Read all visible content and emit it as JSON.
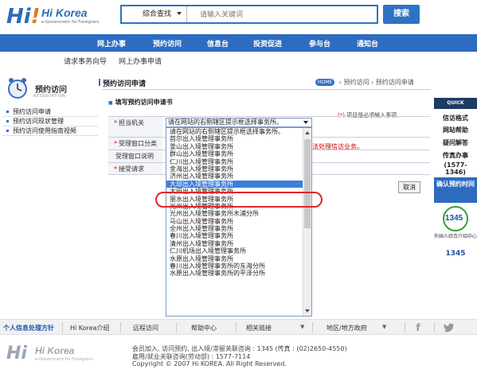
{
  "header": {
    "logo_text": "Hi Korea",
    "logo_sub": "e-Government for Foreigners",
    "search_category": "综合查找",
    "search_placeholder": "请输入关键词",
    "search_button": "搜索"
  },
  "nav": {
    "items": [
      "网上办事",
      "预约访问",
      "信息台",
      "投资促进",
      "参与台",
      "通知台"
    ]
  },
  "subnav": {
    "items": [
      "请求事务向导",
      "网上办事申请"
    ]
  },
  "sidebar": {
    "title": "预约访问",
    "subtitle": "RESERVATION",
    "items": [
      "预约访问申请",
      "预约访问现状管理",
      "预约访问使用指南视频"
    ]
  },
  "main": {
    "title": "预约访问申请",
    "breadcrumb_home": "HOME",
    "breadcrumb": [
      "预约访问",
      "预约访问申请"
    ],
    "section_title": "填写预约访问申请书",
    "required_note_star": "(*)",
    "required_note": "项目是必须输入事项",
    "form": {
      "labels": [
        "担当机关",
        "受理窗口分类",
        "受理窗口说明",
        "接受请求"
      ],
      "required_marks": [
        "*",
        "*",
        "",
        "*"
      ],
      "extra_text": "法处理信访业务。",
      "cancel_button": "取消"
    },
    "dropdown": {
      "selected_value": "请在网站的右侧辖区提示框选择事务所。",
      "options": [
        "请在网站的右侧辖区提示框选择事务所。",
        "首尔出入境管理事务所",
        "釜山出入境管理事务所",
        "群山出入境管理事务所",
        "仁川出入境管理事务所",
        "金海出入境管理事务所",
        "济州出入境管理事务所",
        "大邱出入境管理事务所",
        "大田出入境管理事务所",
        "丽水出入境管理事务所",
        "光州出入境管理事务所",
        "光州出入境管理事务所木浦分所",
        "马山出入境管理事务所",
        "全州出入境管理事务所",
        "春川出入境管理事务所",
        "清州出入境管理事务所",
        "仁川机场出入境管理事务所",
        "水原出入境管理事务所",
        "春川出入境管理事务所的东海分所",
        "水原出入境管理事务所的平泽分所"
      ],
      "highlighted_index": 7
    }
  },
  "quick": {
    "head": "QUICK",
    "items": [
      "信访格式",
      "网站帮助",
      "疑问解答",
      "传真办事",
      "(1577-1346)"
    ],
    "reserve": "确认预约时间",
    "center_number": "1345",
    "center_text": "外国人综合介绍中心",
    "center_number2": "1345"
  },
  "footer": {
    "links": [
      "个人信息处理方针",
      "Hi Korea介绍",
      "远程访问",
      "帮助中心",
      "相关链接",
      "地区/地方政府"
    ],
    "info_lines": [
      "会员加入, 访问预约, 出入境/滞留关联咨询 : 1345 (传真 : (02)2650-4550)",
      "雇用/就业关联咨询(劳动部) : 1577-7114",
      "Copyright © 2007 Hi KOREA. All Right Reserved."
    ]
  }
}
